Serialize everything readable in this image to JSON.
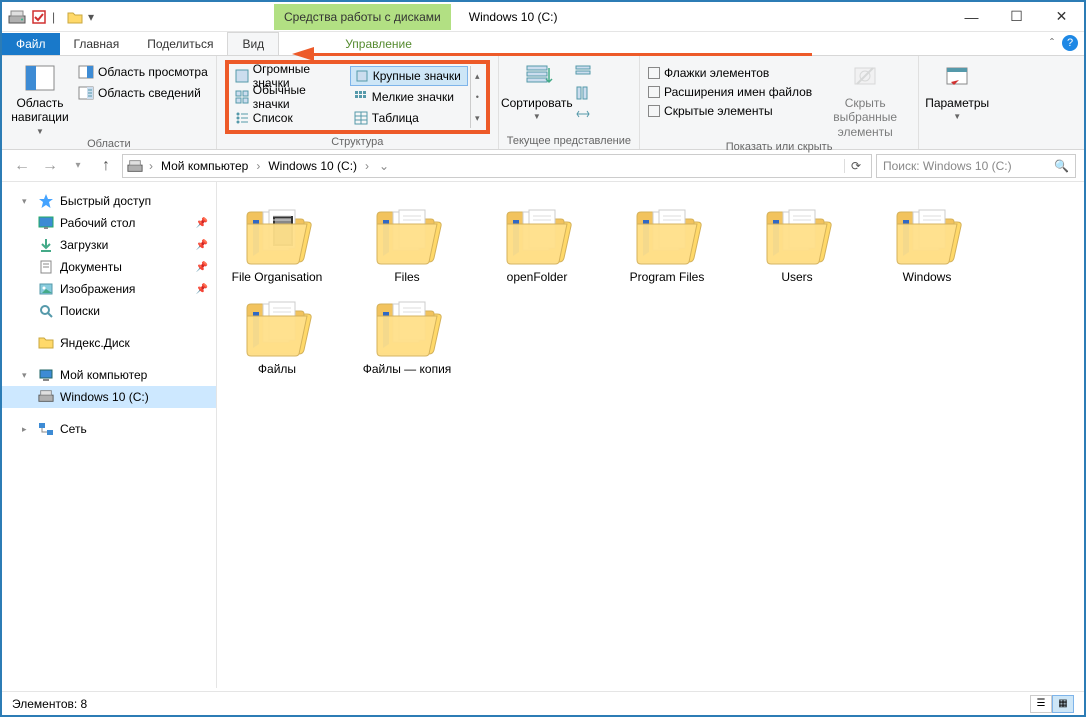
{
  "titlebar": {
    "context_tab": "Средства работы с дисками",
    "window_title": "Windows 10 (C:)"
  },
  "tabs": {
    "file": "Файл",
    "home": "Главная",
    "share": "Поделиться",
    "view": "Вид",
    "manage": "Управление"
  },
  "ribbon": {
    "panes": {
      "nav": "Область навигации",
      "preview": "Область просмотра",
      "details": "Область сведений",
      "group": "Области"
    },
    "layout": {
      "huge": "Огромные значки",
      "large": "Крупные значки",
      "medium": "Обычные значки",
      "small": "Мелкие значки",
      "list": "Список",
      "table": "Таблица",
      "group": "Структура"
    },
    "current": {
      "sort": "Сортировать",
      "group": "Текущее представление"
    },
    "show": {
      "checkboxes": "Флажки элементов",
      "extensions": "Расширения имен файлов",
      "hidden": "Скрытые элементы",
      "hide_selected": "Скрыть выбранные элементы",
      "group": "Показать или скрыть"
    },
    "options": "Параметры"
  },
  "breadcrumb": {
    "root": "Мой компьютер",
    "current": "Windows 10 (C:)"
  },
  "search": {
    "placeholder": "Поиск: Windows 10 (C:)"
  },
  "sidebar": {
    "quick": "Быстрый доступ",
    "desktop": "Рабочий стол",
    "downloads": "Загрузки",
    "documents": "Документы",
    "images": "Изображения",
    "search": "Поиски",
    "yandex": "Яндекс.Диск",
    "my_computer": "Мой компьютер",
    "drive": "Windows 10 (C:)",
    "network": "Сеть"
  },
  "folders": [
    "File Organisation",
    "Files",
    "openFolder",
    "Program Files",
    "Users",
    "Windows",
    "Файлы",
    "Файлы — копия"
  ],
  "status": {
    "count": "Элементов: 8"
  }
}
